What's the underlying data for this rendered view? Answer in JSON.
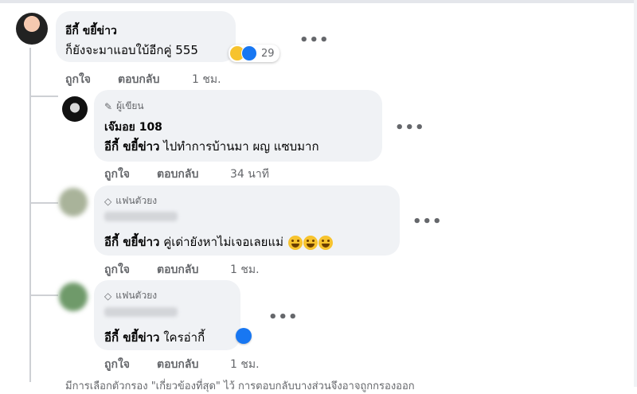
{
  "comment": {
    "author": "อีกี้ ขยี้ข่าว",
    "text": "ก็ยังจะมาแอบใบ้อีกคู่ 555",
    "reaction_count": "29",
    "like_label": "ถูกใจ",
    "reply_label": "ตอบกลับ",
    "time": "1 ชม.",
    "more": "•••"
  },
  "replies": [
    {
      "badge": "ผู้เขียน",
      "badge_icon": "pencil-icon",
      "author": "เจ๊มอย 108",
      "mention": "อีกี้ ขยี้ข่าว",
      "text": " ไปทำการบ้านมา ผญ แซบมาก",
      "like_label": "ถูกใจ",
      "reply_label": "ตอบกลับ",
      "time": "34 นาที",
      "more": "•••"
    },
    {
      "badge": "แฟนตัวยง",
      "badge_icon": "diamond-icon",
      "mention": "อีกี้ ขยี้ข่าว",
      "text": " คู่เด่ายังหาไม่เจอเลยแม่",
      "like_label": "ถูกใจ",
      "reply_label": "ตอบกลับ",
      "time": "1 ชม.",
      "more": "•••"
    },
    {
      "badge": "แฟนตัวยง",
      "badge_icon": "diamond-icon",
      "mention": "อีกี้ ขยี้ข่าว",
      "text": " ใครอ่ากี้",
      "like_label": "ถูกใจ",
      "reply_label": "ตอบกลับ",
      "time": "1 ชม.",
      "more": "•••"
    }
  ],
  "footer_note": "มีการเลือกตัวกรอง \"เกี่ยวข้องที่สุด\" ไว้ การตอบกลับบางส่วนจึงอาจถูกกรองออก",
  "colors": {
    "bubble": "#f0f2f5",
    "like_blue": "#1877f2",
    "muted": "#65676b"
  }
}
